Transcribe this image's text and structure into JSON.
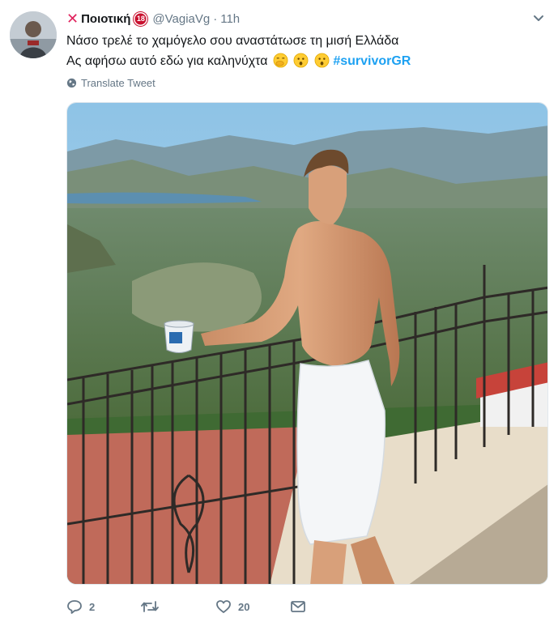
{
  "tweet": {
    "display_name": "Ποιοτική",
    "badge": "18",
    "handle": "@VagiaVg",
    "separator": "·",
    "time": "11h",
    "text_line1": "Νάσο τρελέ το χαμόγελο σου αναστάτωσε τη μισή Ελλάδα",
    "text_line2": "Ας αφήσω αυτό εδώ για καληνύχτα",
    "hashtag": "#survivorGR",
    "translate_label": "Translate Tweet",
    "emojis": [
      "face-with-hand-over-mouth",
      "hushed-face",
      "hushed-face"
    ]
  },
  "actions": {
    "reply_count": "2",
    "retweet_count": "",
    "like_count": "20",
    "message_label": ""
  },
  "icons": {
    "avatar": "profile-avatar",
    "menu": "chevron-down-icon",
    "translate": "globe-icon",
    "reply": "reply-icon",
    "retweet": "retweet-icon",
    "like": "heart-icon",
    "message": "envelope-icon"
  },
  "colors": {
    "hashtag": "#1da1f2",
    "secondary_text": "#657786",
    "x_mark": "#e0245e",
    "badge": "#c8102e"
  }
}
